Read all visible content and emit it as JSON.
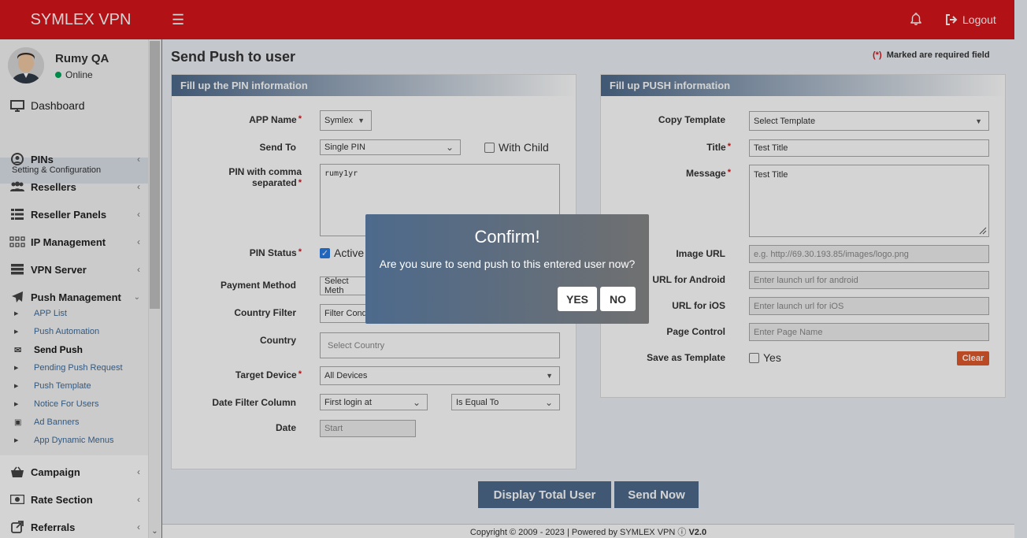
{
  "header": {
    "brand": "SYMLEX VPN",
    "logout_label": "Logout"
  },
  "user": {
    "name": "Rumy QA",
    "status": "Online"
  },
  "sidebar": {
    "dashboard": "Dashboard",
    "section": "Setting & Configuration",
    "items": [
      "PINs",
      "Resellers",
      "Reseller Panels",
      "IP Management",
      "VPN Server",
      "Push Management"
    ],
    "push_sub": [
      "APP List",
      "Push Automation",
      "Send Push",
      "Pending Push Request",
      "Push Template",
      "Notice For Users",
      "Ad Banners",
      "App Dynamic Menus"
    ],
    "bottom": [
      "Campaign",
      "Rate Section",
      "Referrals"
    ]
  },
  "page": {
    "title": "Send Push to user",
    "req_star": "(*)",
    "req_text": "Marked are required field"
  },
  "pin_panel": {
    "title": "Fill up the PIN information",
    "app_name_label": "APP Name",
    "app_name": "Symlex",
    "send_to_label": "Send To",
    "send_to": "Single PIN",
    "with_child": "With Child",
    "pin_label": "PIN with comma separated",
    "pin_value": "rumy1yr",
    "pin_status_label": "PIN Status",
    "pin_status_active": "Active",
    "payment_label": "Payment Method",
    "payment_value": "Select Meth",
    "country_filter_label": "Country Filter",
    "country_filter_value": "Filter Cond",
    "country_label": "Country",
    "country_placeholder": "Select Country",
    "target_label": "Target Device",
    "target_value": "All Devices",
    "date_col_label": "Date Filter Column",
    "date_col_value": "First login at",
    "date_op_value": "Is Equal To",
    "date_label": "Date",
    "date_placeholder": "Start"
  },
  "push_panel": {
    "title": "Fill up PUSH information",
    "copy_label": "Copy Template",
    "copy_value": "Select Template",
    "title_label": "Title",
    "title_value": "Test Title",
    "message_label": "Message",
    "message_value": "Test Title",
    "image_label": "Image URL",
    "image_placeholder": "e.g. http://69.30.193.85/images/logo.png",
    "android_label": "URL for Android",
    "android_placeholder": "Enter launch url for android",
    "ios_label": "URL for iOS",
    "ios_placeholder": "Enter launch url for iOS",
    "page_label": "Page Control",
    "page_placeholder": "Enter Page Name",
    "save_label": "Save as Template",
    "save_yes": "Yes",
    "clear": "Clear"
  },
  "actions": {
    "display_total": "Display Total User",
    "send_now": "Send Now"
  },
  "dialog": {
    "title": "Confirm!",
    "message": "Are you sure to send push to this entered user now?",
    "yes": "YES",
    "no": "NO"
  },
  "footer": {
    "text": "Copyright © 2009 - 2023 | Powered by SYMLEX VPN",
    "version": "V2.0"
  },
  "colors": {
    "header": "#d7161b",
    "panel_head": "#4d6a8c",
    "button": "#4d6a8c",
    "clear": "#e05a2b"
  }
}
